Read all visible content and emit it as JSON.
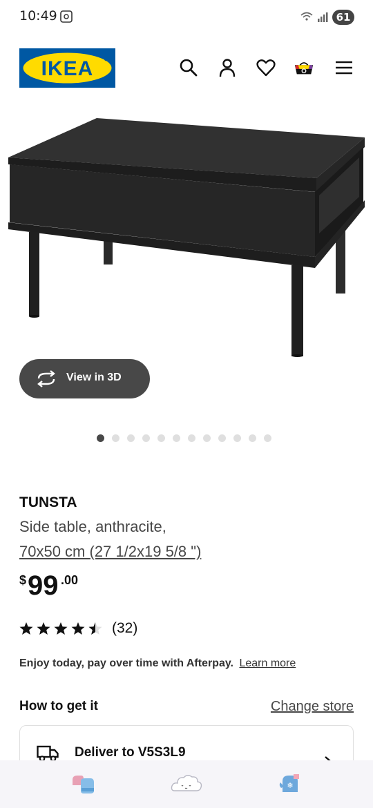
{
  "status_bar": {
    "time": "10:49",
    "battery": "61"
  },
  "header": {
    "logo_text": "IKEA",
    "icons": [
      "search-icon",
      "account-icon",
      "heart-icon",
      "cart-icon",
      "menu-icon"
    ]
  },
  "gallery": {
    "view3d_label": "View in 3D",
    "dot_count": 12,
    "active_dot": 1
  },
  "product": {
    "name": "TUNSTA",
    "description": "Side table, anthracite,",
    "size": "70x50 cm (27 1/2x19 5/8 \")",
    "price_currency": "$",
    "price_int": "99",
    "price_dec": ".00",
    "rating": 4.5,
    "review_count": "(32)"
  },
  "afterpay": {
    "text": "Enjoy today, pay over time with Afterpay.",
    "link": "Learn more"
  },
  "fulfillment": {
    "title": "How to get it",
    "change_store": "Change store",
    "delivery_label": "Deliver to V5S3L9"
  },
  "colors": {
    "ikea_blue": "#0058A3",
    "ikea_yellow": "#FFDB00",
    "button_dark": "#484848",
    "bottom_bar": "#F6F5F9"
  }
}
